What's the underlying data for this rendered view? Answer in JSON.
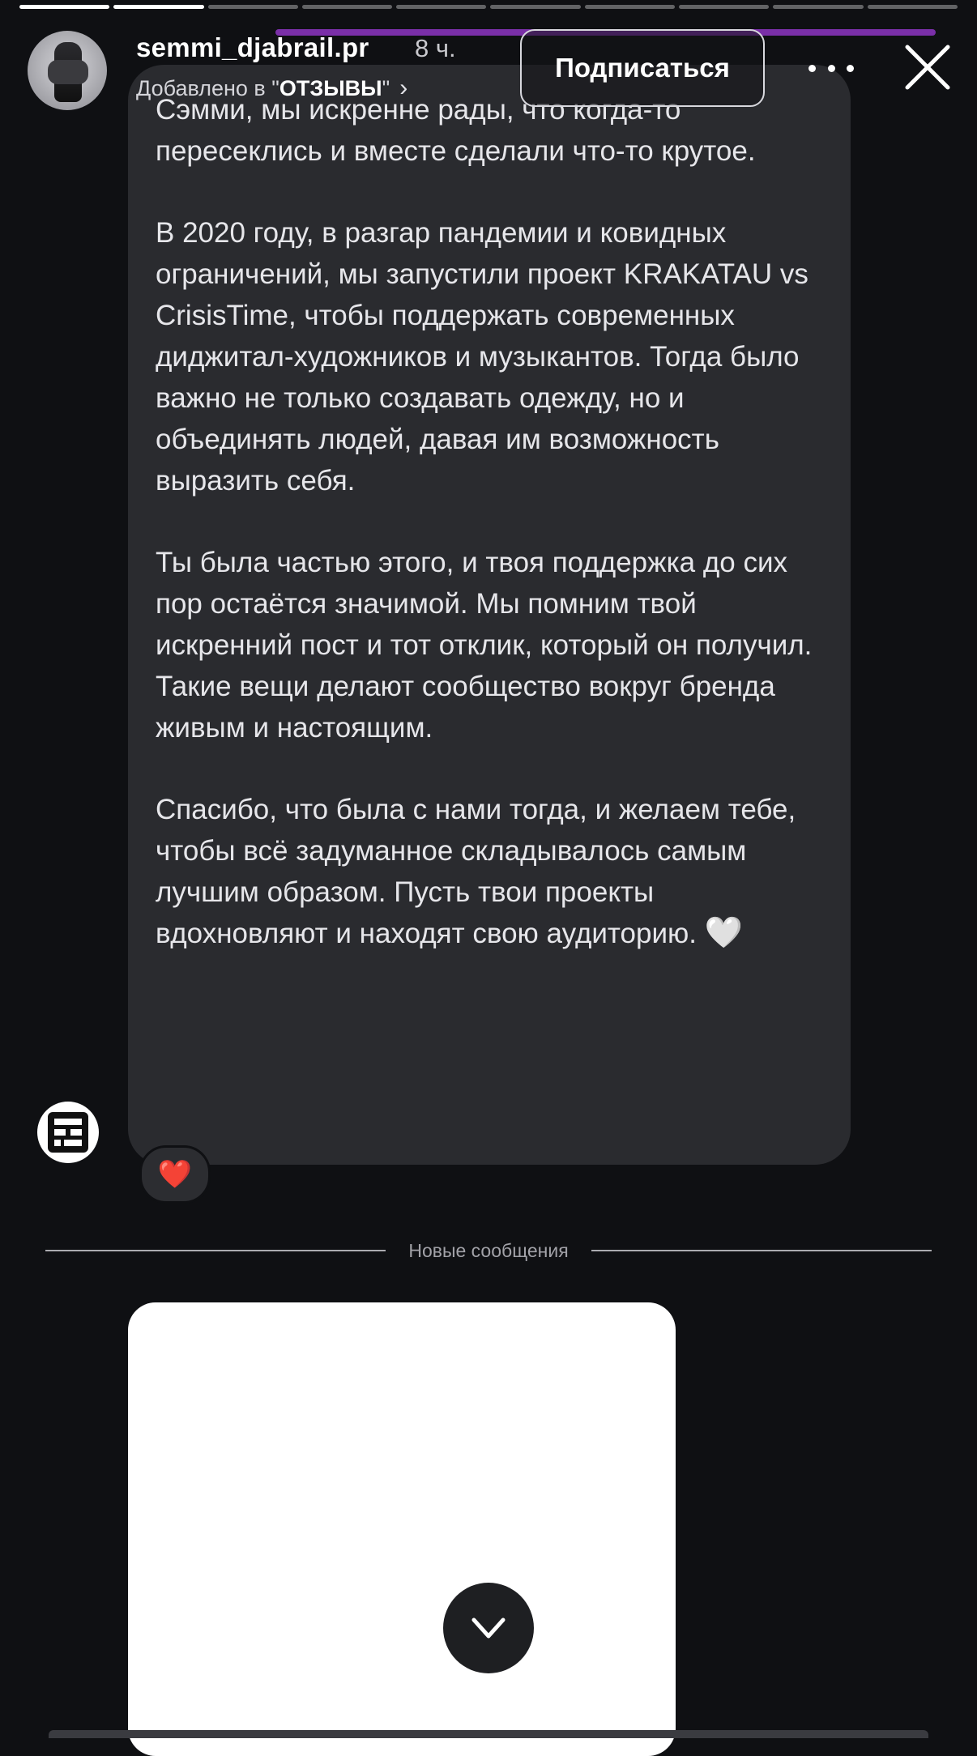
{
  "story": {
    "progress_segments": 10,
    "progress_completed": 2,
    "username": "semmi_djabrail.pr",
    "time": "8 ч.",
    "added_prefix": "Добавлено в \"",
    "highlight_name": "ОТЗЫВЫ",
    "added_suffix": "\"",
    "subscribe_label": "Подписаться"
  },
  "message": {
    "paragraphs": [
      "Сэмми, мы искренне рады, что когда-то пересеклись и вместе сделали что-то крутое.",
      "В 2020 году, в разгар пандемии и ковидных ограничений, мы запустили проект KRAKATAU vs CrisisTime, чтобы поддержать современных диджитал-художников и музыкантов. Тогда было важно не только создавать одежду, но и объединять людей, давая им возможность выразить себя.",
      "Ты была частью этого, и твоя поддержка до сих пор остаётся значимой. Мы помним твой искренний пост и тот отклик, который он получил. Такие вещи делают сообщество вокруг бренда живым и настоящим.",
      "Спасибо, что была с нами тогда, и желаем тебе, чтобы всё задуманное складывалось самым лучшим образом. Пусть твои проекты вдохновляют и находят свою аудиторию."
    ],
    "end_emoji": "🤍",
    "reaction": "❤️"
  },
  "divider": {
    "label": "Новые сообщения"
  },
  "colors": {
    "background": "#0f1013",
    "bubble": "#2a2b2f",
    "accent_purple": "#7a2fa8",
    "reaction_red": "#e8203a"
  }
}
